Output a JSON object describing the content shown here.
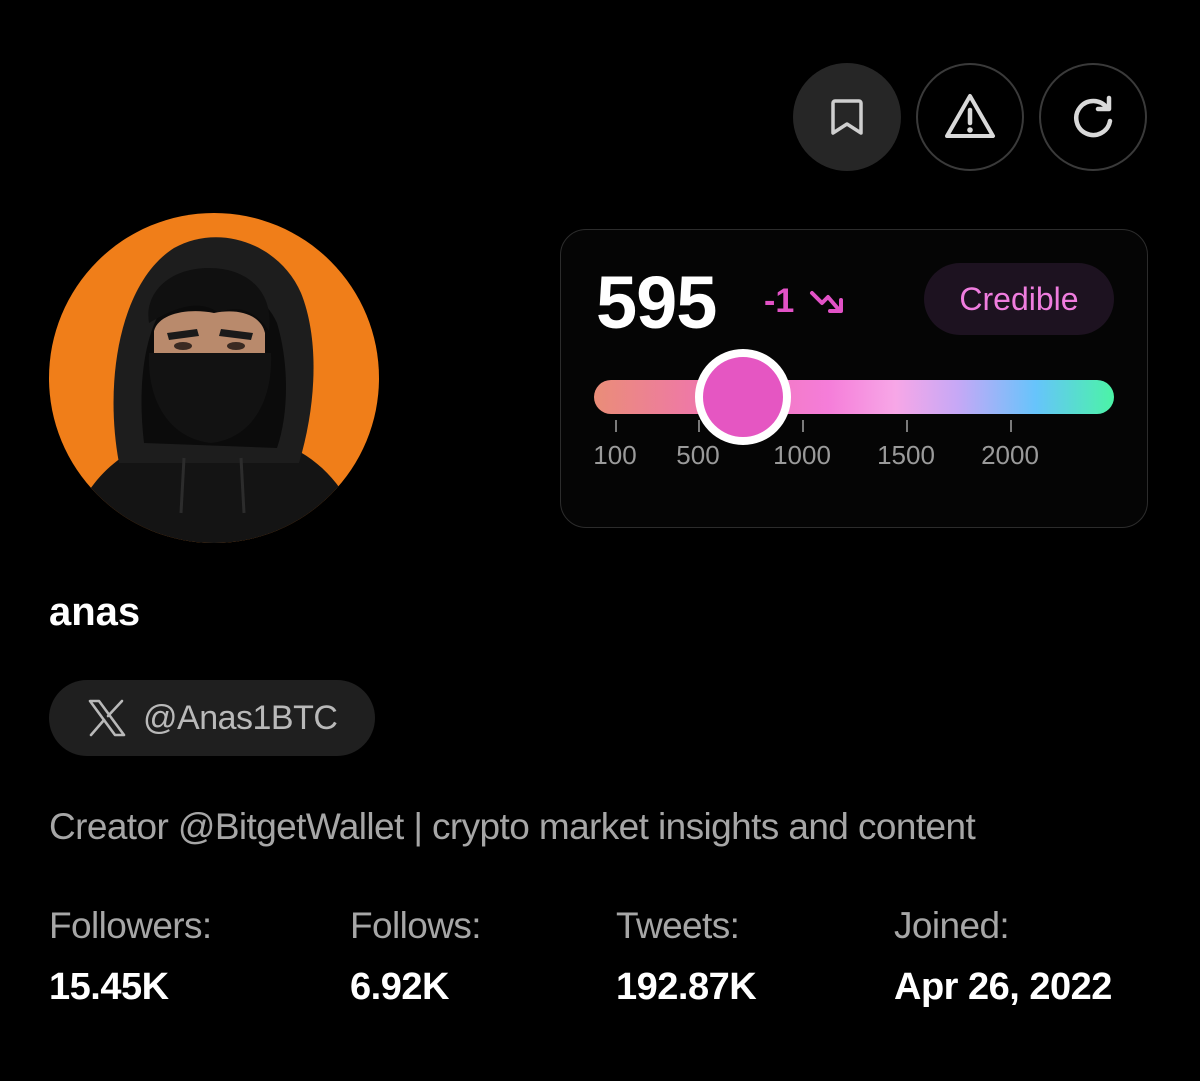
{
  "toolbar": {
    "bookmark_icon": "bookmark-icon",
    "report_icon": "warning-icon",
    "refresh_icon": "refresh-icon"
  },
  "profile": {
    "avatar": "hooded-masked-figure-avatar",
    "name": "anas",
    "handle": "@Anas1BTC",
    "handle_icon": "x-logo-icon",
    "bio": "Creator @BitgetWallet | crypto market insights and content"
  },
  "score": {
    "value": "595",
    "delta": "-1",
    "trend_icon": "trend-down-icon",
    "status": "Credible",
    "slider_value": 595,
    "scale_ticks": [
      "100",
      "500",
      "1000",
      "1500",
      "2000"
    ]
  },
  "stats": [
    {
      "label": "Followers:",
      "value": "15.45K"
    },
    {
      "label": "Follows:",
      "value": "6.92K"
    },
    {
      "label": "Tweets:",
      "value": "192.87K"
    },
    {
      "label": "Joined:",
      "value": "Apr 26, 2022"
    }
  ],
  "colors": {
    "background": "#000000",
    "accent_pink": "#e556c2",
    "badge_text": "#f07ddf",
    "avatar_bg": "#f07e19"
  }
}
